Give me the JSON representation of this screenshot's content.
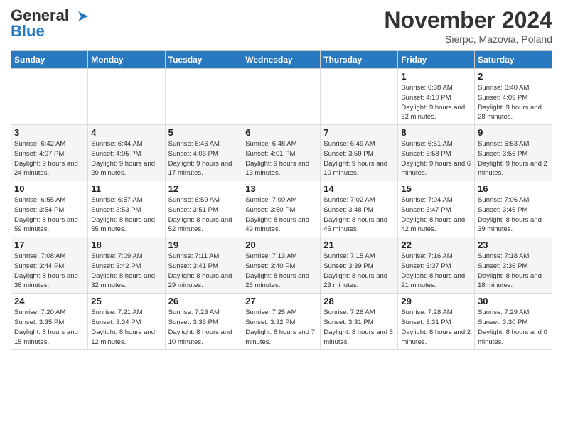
{
  "header": {
    "logo_line1": "General",
    "logo_line2": "Blue",
    "month": "November 2024",
    "location": "Sierpc, Mazovia, Poland"
  },
  "days_of_week": [
    "Sunday",
    "Monday",
    "Tuesday",
    "Wednesday",
    "Thursday",
    "Friday",
    "Saturday"
  ],
  "weeks": [
    [
      {
        "day": "",
        "info": ""
      },
      {
        "day": "",
        "info": ""
      },
      {
        "day": "",
        "info": ""
      },
      {
        "day": "",
        "info": ""
      },
      {
        "day": "",
        "info": ""
      },
      {
        "day": "1",
        "info": "Sunrise: 6:38 AM\nSunset: 4:10 PM\nDaylight: 9 hours and 32 minutes."
      },
      {
        "day": "2",
        "info": "Sunrise: 6:40 AM\nSunset: 4:09 PM\nDaylight: 9 hours and 28 minutes."
      }
    ],
    [
      {
        "day": "3",
        "info": "Sunrise: 6:42 AM\nSunset: 4:07 PM\nDaylight: 9 hours and 24 minutes."
      },
      {
        "day": "4",
        "info": "Sunrise: 6:44 AM\nSunset: 4:05 PM\nDaylight: 9 hours and 20 minutes."
      },
      {
        "day": "5",
        "info": "Sunrise: 6:46 AM\nSunset: 4:03 PM\nDaylight: 9 hours and 17 minutes."
      },
      {
        "day": "6",
        "info": "Sunrise: 6:48 AM\nSunset: 4:01 PM\nDaylight: 9 hours and 13 minutes."
      },
      {
        "day": "7",
        "info": "Sunrise: 6:49 AM\nSunset: 3:59 PM\nDaylight: 9 hours and 10 minutes."
      },
      {
        "day": "8",
        "info": "Sunrise: 6:51 AM\nSunset: 3:58 PM\nDaylight: 9 hours and 6 minutes."
      },
      {
        "day": "9",
        "info": "Sunrise: 6:53 AM\nSunset: 3:56 PM\nDaylight: 9 hours and 2 minutes."
      }
    ],
    [
      {
        "day": "10",
        "info": "Sunrise: 6:55 AM\nSunset: 3:54 PM\nDaylight: 8 hours and 59 minutes."
      },
      {
        "day": "11",
        "info": "Sunrise: 6:57 AM\nSunset: 3:53 PM\nDaylight: 8 hours and 55 minutes."
      },
      {
        "day": "12",
        "info": "Sunrise: 6:59 AM\nSunset: 3:51 PM\nDaylight: 8 hours and 52 minutes."
      },
      {
        "day": "13",
        "info": "Sunrise: 7:00 AM\nSunset: 3:50 PM\nDaylight: 8 hours and 49 minutes."
      },
      {
        "day": "14",
        "info": "Sunrise: 7:02 AM\nSunset: 3:48 PM\nDaylight: 8 hours and 45 minutes."
      },
      {
        "day": "15",
        "info": "Sunrise: 7:04 AM\nSunset: 3:47 PM\nDaylight: 8 hours and 42 minutes."
      },
      {
        "day": "16",
        "info": "Sunrise: 7:06 AM\nSunset: 3:45 PM\nDaylight: 8 hours and 39 minutes."
      }
    ],
    [
      {
        "day": "17",
        "info": "Sunrise: 7:08 AM\nSunset: 3:44 PM\nDaylight: 8 hours and 36 minutes."
      },
      {
        "day": "18",
        "info": "Sunrise: 7:09 AM\nSunset: 3:42 PM\nDaylight: 8 hours and 32 minutes."
      },
      {
        "day": "19",
        "info": "Sunrise: 7:11 AM\nSunset: 3:41 PM\nDaylight: 8 hours and 29 minutes."
      },
      {
        "day": "20",
        "info": "Sunrise: 7:13 AM\nSunset: 3:40 PM\nDaylight: 8 hours and 26 minutes."
      },
      {
        "day": "21",
        "info": "Sunrise: 7:15 AM\nSunset: 3:39 PM\nDaylight: 8 hours and 23 minutes."
      },
      {
        "day": "22",
        "info": "Sunrise: 7:16 AM\nSunset: 3:37 PM\nDaylight: 8 hours and 21 minutes."
      },
      {
        "day": "23",
        "info": "Sunrise: 7:18 AM\nSunset: 3:36 PM\nDaylight: 8 hours and 18 minutes."
      }
    ],
    [
      {
        "day": "24",
        "info": "Sunrise: 7:20 AM\nSunset: 3:35 PM\nDaylight: 8 hours and 15 minutes."
      },
      {
        "day": "25",
        "info": "Sunrise: 7:21 AM\nSunset: 3:34 PM\nDaylight: 8 hours and 12 minutes."
      },
      {
        "day": "26",
        "info": "Sunrise: 7:23 AM\nSunset: 3:33 PM\nDaylight: 8 hours and 10 minutes."
      },
      {
        "day": "27",
        "info": "Sunrise: 7:25 AM\nSunset: 3:32 PM\nDaylight: 8 hours and 7 minutes."
      },
      {
        "day": "28",
        "info": "Sunrise: 7:26 AM\nSunset: 3:31 PM\nDaylight: 8 hours and 5 minutes."
      },
      {
        "day": "29",
        "info": "Sunrise: 7:28 AM\nSunset: 3:31 PM\nDaylight: 8 hours and 2 minutes."
      },
      {
        "day": "30",
        "info": "Sunrise: 7:29 AM\nSunset: 3:30 PM\nDaylight: 8 hours and 0 minutes."
      }
    ]
  ]
}
